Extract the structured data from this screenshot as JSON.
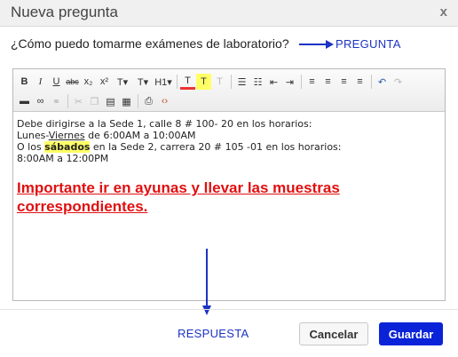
{
  "dialog": {
    "title": "Nueva pregunta",
    "close_label": "x"
  },
  "question": {
    "text": "¿Cómo puedo tomarme exámenes de laboratorio?"
  },
  "annotations": {
    "question_label": "PREGUNTA",
    "answer_label": "RESPUESTA",
    "color": "#1c33c4"
  },
  "toolbar": {
    "row1": [
      {
        "icon": "bold-icon",
        "glyph": "B"
      },
      {
        "icon": "italic-icon",
        "glyph": "I"
      },
      {
        "icon": "underline-icon",
        "glyph": "U"
      },
      {
        "icon": "strikethrough-icon",
        "glyph": "abc"
      },
      {
        "icon": "subscript-icon",
        "glyph": "x₂"
      },
      {
        "icon": "superscript-icon",
        "glyph": "x²"
      },
      {
        "icon": "font-family-icon",
        "glyph": "T▾"
      },
      {
        "icon": "font-size-icon",
        "glyph": "TT▾"
      },
      {
        "icon": "heading-icon",
        "glyph": "H1▾"
      },
      {
        "icon": "text-color-icon",
        "glyph": "T"
      },
      {
        "icon": "highlight-icon",
        "glyph": "T"
      },
      {
        "icon": "clear-format-icon",
        "glyph": "T"
      },
      {
        "icon": "bullet-list-icon",
        "glyph": "☰"
      },
      {
        "icon": "numbered-list-icon",
        "glyph": "☷"
      },
      {
        "icon": "outdent-icon",
        "glyph": "⇤"
      },
      {
        "icon": "indent-icon",
        "glyph": "⇥"
      },
      {
        "icon": "align-left-icon",
        "glyph": "≡"
      },
      {
        "icon": "align-center-icon",
        "glyph": "≡"
      },
      {
        "icon": "align-right-icon",
        "glyph": "≡"
      },
      {
        "icon": "align-justify-icon",
        "glyph": "≡"
      },
      {
        "icon": "undo-icon",
        "glyph": "↶"
      },
      {
        "icon": "redo-icon",
        "glyph": "↷"
      }
    ],
    "row2": [
      {
        "icon": "horizontal-rule-icon",
        "glyph": "▬"
      },
      {
        "icon": "link-icon",
        "glyph": "∞"
      },
      {
        "icon": "unlink-icon",
        "glyph": "⚭"
      },
      {
        "icon": "cut-icon",
        "glyph": "✂"
      },
      {
        "icon": "copy-icon",
        "glyph": "❐"
      },
      {
        "icon": "paste-icon",
        "glyph": "▤"
      },
      {
        "icon": "paste-text-icon",
        "glyph": "▦"
      },
      {
        "icon": "print-icon",
        "glyph": "⎙"
      },
      {
        "icon": "source-code-icon",
        "glyph": "‹›"
      }
    ]
  },
  "answer": {
    "line1": "Debe dirigirse a la Sede 1, calle 8 # 100- 20 en los horarios:",
    "line2_pre": "Lunes-",
    "line2_viernes": "Viernes",
    "line2_post": " de 6:00AM a 10:00AM",
    "line3_pre": "O los ",
    "line3_sabados": "sábados",
    "line3_post": " en la Sede 2, carrera 20 # 105 -01 en los horarios:",
    "line4": "8:00AM a 12:00PM",
    "important": "Importante ir en ayunas y llevar las muestras correspondientes."
  },
  "footer": {
    "cancel_label": "Cancelar",
    "save_label": "Guardar",
    "primary_color": "#0a23d8"
  }
}
